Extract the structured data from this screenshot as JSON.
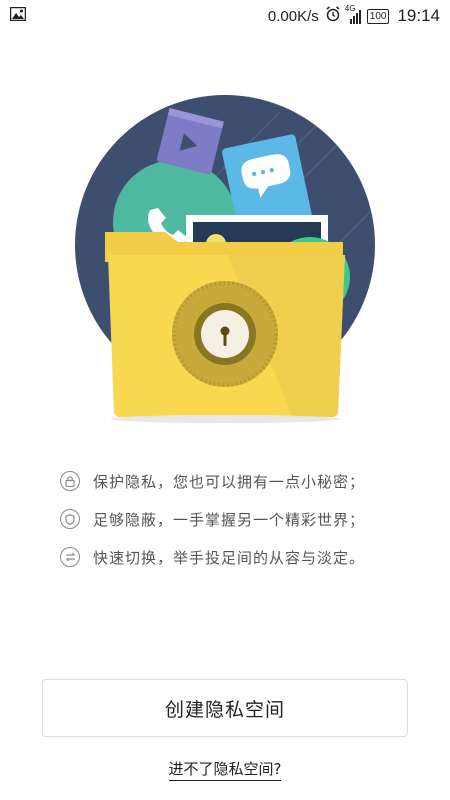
{
  "status_bar": {
    "network_speed": "0.00K/s",
    "network_type": "4G",
    "battery": "100",
    "time": "19:14",
    "icons": [
      "image-icon",
      "alarm-icon",
      "signal-icon",
      "battery-icon"
    ]
  },
  "features": [
    {
      "icon": "lock-icon",
      "text": "保护隐私，您也可以拥有一点小秘密；"
    },
    {
      "icon": "shield-icon",
      "text": "足够隐蔽，一手掌握另一个精彩世界；"
    },
    {
      "icon": "switch-icon",
      "text": "快速切换，举手投足间的从容与淡定。"
    }
  ],
  "actions": {
    "create_label": "创建隐私空间",
    "help_label": "进不了隐私空间?"
  },
  "colors": {
    "circle_bg": "#3e4e6e",
    "folder": "#f7d84f",
    "lock_ring": "#c7aa3a",
    "purple_card": "#7e7bc7",
    "blue_card": "#5cb8e6",
    "green_circle": "#4fb8a0"
  }
}
